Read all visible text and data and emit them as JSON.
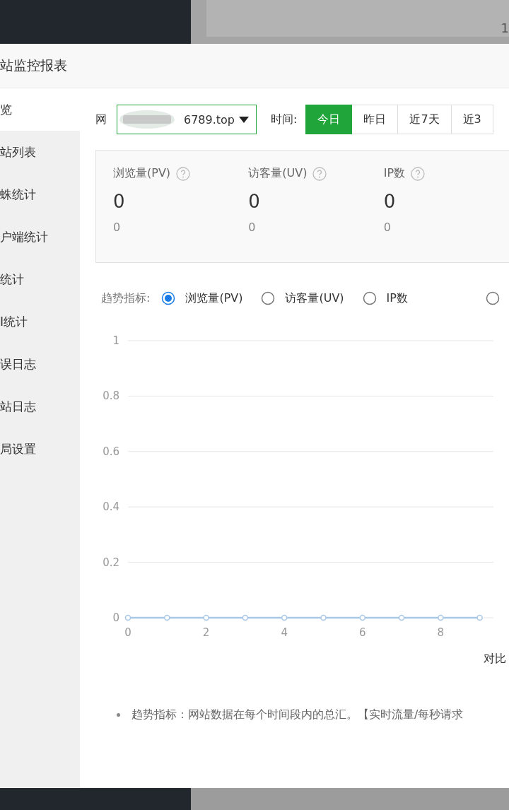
{
  "background": {
    "panel_text": "1"
  },
  "modal": {
    "title": "站监控报表",
    "nav": [
      {
        "label": "览",
        "selected": true
      },
      {
        "label": "站列表",
        "selected": false
      },
      {
        "label": "蛛统计",
        "selected": false
      },
      {
        "label": "户端统计",
        "selected": false
      },
      {
        "label": "统计",
        "selected": false
      },
      {
        "label": "I统计",
        "selected": false
      },
      {
        "label": "误日志",
        "selected": false
      },
      {
        "label": "站日志",
        "selected": false
      },
      {
        "label": "局设置",
        "selected": false
      }
    ],
    "site": {
      "label": "网",
      "value": "6789.top"
    },
    "time": {
      "label": "时间:",
      "options": [
        {
          "label": "今日",
          "selected": true
        },
        {
          "label": "昨日",
          "selected": false
        },
        {
          "label": "近7天",
          "selected": false
        },
        {
          "label": "近3",
          "selected": false
        }
      ]
    },
    "stats": [
      {
        "label": "浏览量(PV)",
        "value": "0",
        "sub": "0"
      },
      {
        "label": "访客量(UV)",
        "value": "0",
        "sub": "0"
      },
      {
        "label": "IP数",
        "value": "0",
        "sub": "0"
      }
    ],
    "trend": {
      "label": "趋势指标:",
      "options": [
        {
          "label": "浏览量(PV)",
          "selected": true
        },
        {
          "label": "访客量(UV)",
          "selected": false
        },
        {
          "label": "IP数",
          "selected": false
        },
        {
          "selected": false
        }
      ]
    },
    "chart_data": {
      "type": "line",
      "x": [
        0,
        1,
        2,
        3,
        4,
        5,
        6,
        7,
        8,
        9
      ],
      "series": [
        {
          "color": "#a9c8e8",
          "marker": "circle",
          "values": [
            0,
            0,
            0,
            0,
            0,
            0,
            0,
            0,
            0,
            0
          ]
        }
      ],
      "xticks": [
        0,
        2,
        4,
        6,
        8
      ],
      "yticks": [
        0,
        {
          "value": 0.2,
          "label": "0.2"
        },
        {
          "value": 0.4,
          "label": "0.4"
        },
        {
          "value": 0.6,
          "label": "0.6"
        },
        {
          "value": 0.8,
          "label": "0.8"
        },
        1
      ],
      "ylim": [
        0,
        1
      ],
      "xlim": [
        0,
        9.35
      ],
      "grid": true
    },
    "compare": "对比",
    "notes": [
      "趋势指标：网站数据在每个时间段内的总汇。【实时流量/每秒请求"
    ]
  }
}
